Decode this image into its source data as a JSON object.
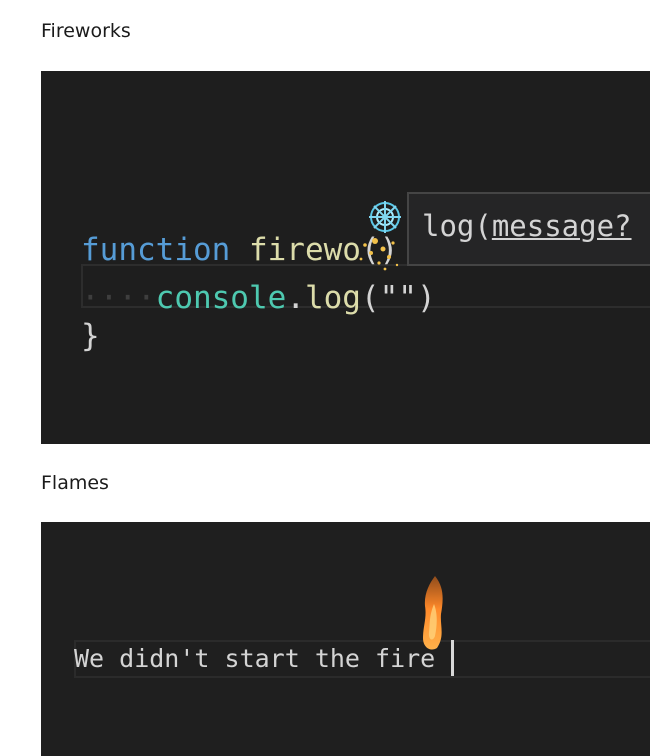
{
  "sections": {
    "fireworks": {
      "title": "Fireworks",
      "code": {
        "line1": {
          "keyword": "function",
          "name_visible": "firewo",
          "trailing": "() {"
        },
        "line2": {
          "indent": "····",
          "object": "console",
          "dot": ".",
          "method": "log",
          "args": "(\"\")"
        },
        "line3": {
          "brace": "}"
        }
      },
      "hover": {
        "prefix": "log(",
        "param": "message?"
      }
    },
    "flames": {
      "title": "Flames",
      "text": "We didn't start the fire"
    }
  },
  "colors": {
    "editor_bg": "#1e1e1e",
    "keyword": "#569cd6",
    "function": "#dcdcaa",
    "class": "#4ec9b0",
    "text": "#d4d4d4"
  },
  "icons": {
    "firework": "firework-burst-icon",
    "flame": "flame-icon"
  }
}
